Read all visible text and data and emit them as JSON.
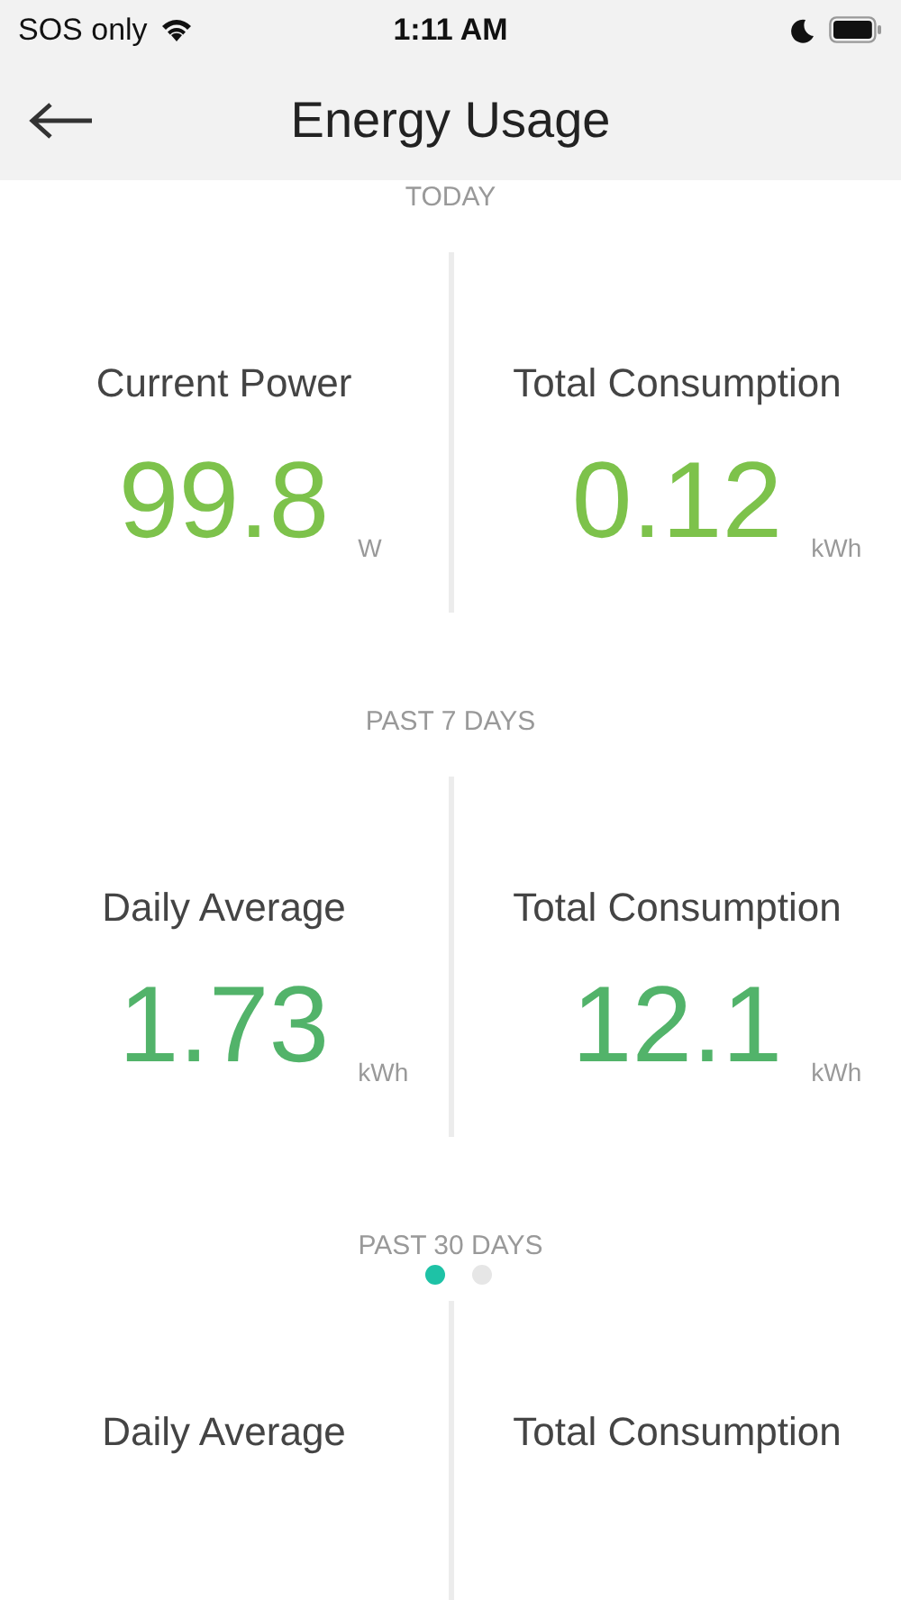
{
  "status_bar": {
    "carrier": "SOS only",
    "time": "1:11 AM"
  },
  "header": {
    "title": "Energy Usage"
  },
  "sections": [
    {
      "label": "TODAY",
      "color": "#7dc24b",
      "metrics": [
        {
          "title": "Current Power",
          "value": "99.8",
          "unit": "W"
        },
        {
          "title": "Total Consumption",
          "value": "0.12",
          "unit": "kWh"
        }
      ]
    },
    {
      "label": "PAST 7 DAYS",
      "color": "#52b36a",
      "metrics": [
        {
          "title": "Daily Average",
          "value": "1.73",
          "unit": "kWh"
        },
        {
          "title": "Total Consumption",
          "value": "12.1",
          "unit": "kWh"
        }
      ]
    },
    {
      "label": "PAST 30 DAYS",
      "metrics": [
        {
          "title": "Daily Average"
        },
        {
          "title": "Total Consumption"
        }
      ]
    }
  ],
  "page_dots": [
    {
      "selected": true
    },
    {
      "selected": false
    }
  ]
}
